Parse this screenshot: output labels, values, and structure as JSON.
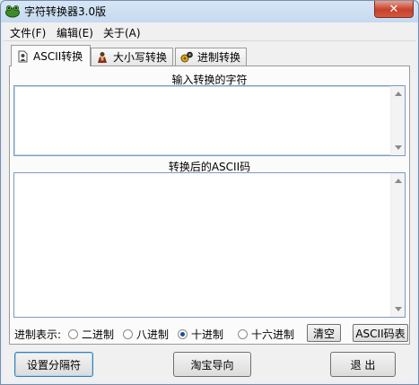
{
  "window": {
    "title": "字符转换器3.0版",
    "close_glyph": "✕"
  },
  "menu": [
    "文件(F)",
    "编辑(E)",
    "关于(A)"
  ],
  "tabs": [
    {
      "label": "ASCII转换",
      "icon": "document-person-icon",
      "active": true
    },
    {
      "label": "大小写转换",
      "icon": "person-icon",
      "active": false
    },
    {
      "label": "进制转换",
      "icon": "gears-icon",
      "active": false
    }
  ],
  "input_group": {
    "label": "输入转换的字符",
    "value": ""
  },
  "output_group": {
    "label": "转换后的ASCII码",
    "value": ""
  },
  "radix": {
    "label": "进制表示:",
    "options": [
      "二进制",
      "八进制",
      "十进制",
      "十六进制"
    ],
    "selected": "十进制"
  },
  "buttons": {
    "clear": "清空",
    "ascii_table": "ASCII码表",
    "set_separator": "设置分隔符",
    "taobao_guide": "淘宝导向",
    "exit": "退 出"
  },
  "colors": {
    "accent": "#1f4e8c",
    "close_red": "#c7402b",
    "title_bg": "#c5d9ef"
  }
}
